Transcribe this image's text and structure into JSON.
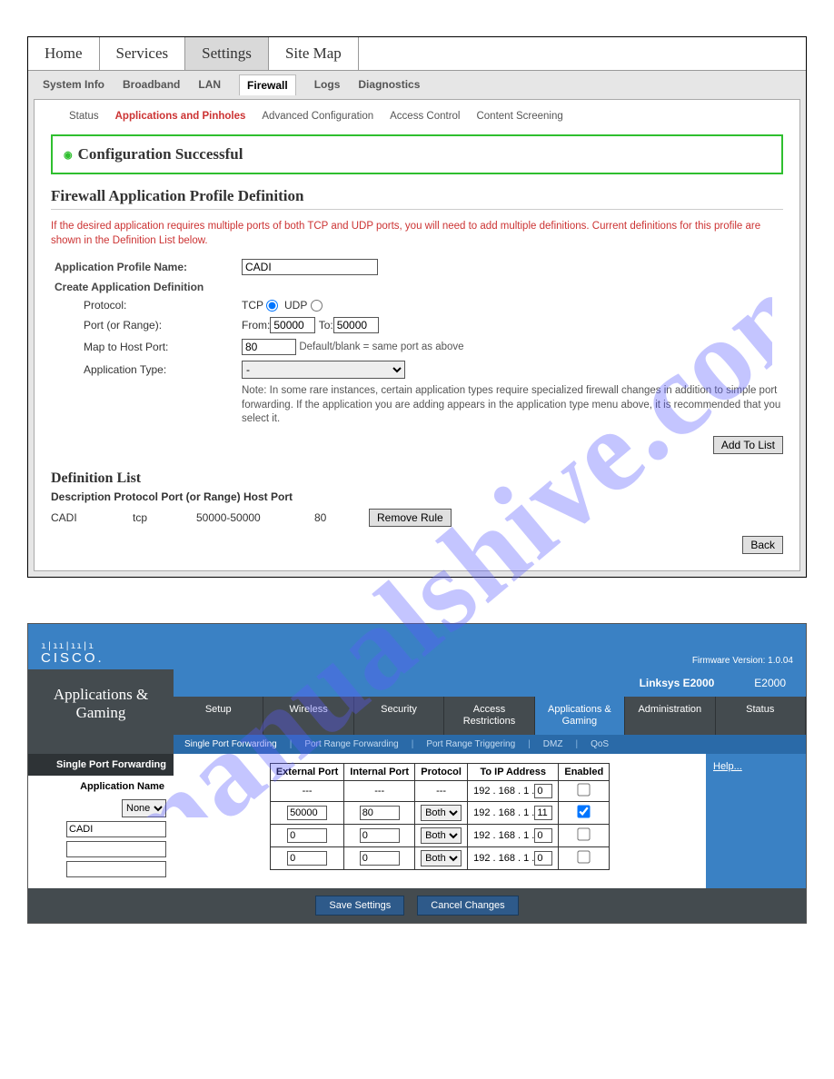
{
  "watermark": "manualshive.com",
  "s1": {
    "tabs": [
      "Home",
      "Services",
      "Settings",
      "Site Map"
    ],
    "subtabs": [
      "System Info",
      "Broadband",
      "LAN",
      "Firewall",
      "Logs",
      "Diagnostics"
    ],
    "pnav": [
      "Status",
      "Applications and Pinholes",
      "Advanced Configuration",
      "Access Control",
      "Content Screening"
    ],
    "ok_title": "Configuration Successful",
    "page_title": "Firewall Application Profile Definition",
    "desc": "If the desired application requires multiple ports of both TCP and UDP ports, you will need to add multiple definitions. Current definitions for this profile are shown in the Definition List below.",
    "profile_label": "Application Profile Name:",
    "profile_value": "CADI",
    "create_label": "Create Application Definition",
    "protocol_label": "Protocol:",
    "tcp_label": "TCP",
    "udp_label": "UDP",
    "port_label": "Port (or Range):",
    "from_label": "From:",
    "from_value": "50000",
    "to_label": "To:",
    "to_value": "50000",
    "maphost_label": "Map to Host Port:",
    "maphost_value": "80",
    "maphost_hint": "Default/blank = same port as above",
    "apptype_label": "Application Type:",
    "apptype_value": "-",
    "note": "Note: In some rare instances, certain application types require specialized firewall changes in addition to simple port forwarding. If the application you are adding appears in the application type menu above, it is recommended that you select it.",
    "add_btn": "Add To List",
    "deflist_title": "Definition List",
    "deflist_headers": "Description Protocol Port (or Range) Host Port",
    "rule": {
      "desc": "CADI",
      "proto": "tcp",
      "port": "50000-50000",
      "host": "80"
    },
    "remove_btn": "Remove Rule",
    "back_btn": "Back"
  },
  "s2": {
    "brand": "CISCO.",
    "firmware": "Firmware Version: 1.0.04",
    "model_a": "Linksys E2000",
    "model_b": "E2000",
    "section": "Applications & Gaming",
    "mtabs": [
      "Setup",
      "Wireless",
      "Security",
      "Access Restrictions",
      "Applications & Gaming",
      "Administration",
      "Status"
    ],
    "stabs": [
      "Single Port Forwarding",
      "Port Range Forwarding",
      "Port Range Triggering",
      "DMZ",
      "QoS"
    ],
    "side_h": "Single Port Forwarding",
    "side_lab": "Application Name",
    "side_none": "None",
    "side_in1": "CADI",
    "th": [
      "External Port",
      "Internal Port",
      "Protocol",
      "To IP Address",
      "Enabled"
    ],
    "rows": [
      {
        "ext": "---",
        "int": "---",
        "proto": "---",
        "ip_prefix": "192 . 168 . 1 .",
        "ip_last": "0",
        "en": false,
        "fixed": true
      },
      {
        "ext": "50000",
        "int": "80",
        "proto": "Both",
        "ip_prefix": "192 . 168 . 1 .",
        "ip_last": "11",
        "en": true
      },
      {
        "ext": "0",
        "int": "0",
        "proto": "Both",
        "ip_prefix": "192 . 168 . 1 .",
        "ip_last": "0",
        "en": false
      },
      {
        "ext": "0",
        "int": "0",
        "proto": "Both",
        "ip_prefix": "192 . 168 . 1 .",
        "ip_last": "0",
        "en": false
      }
    ],
    "help": "Help...",
    "save": "Save Settings",
    "cancel": "Cancel Changes"
  }
}
